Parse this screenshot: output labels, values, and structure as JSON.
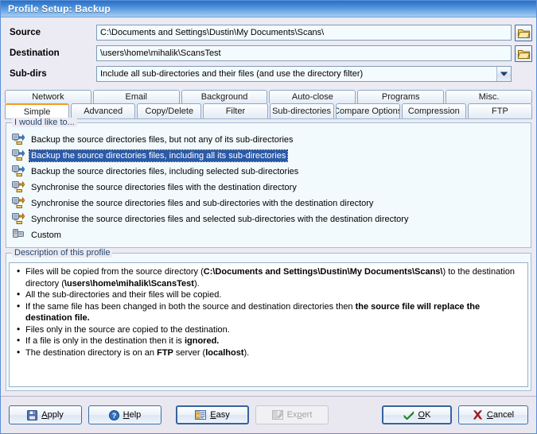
{
  "window": {
    "title": "Profile Setup: Backup"
  },
  "fields": {
    "source": {
      "label": "Source",
      "value": "C:\\Documents and Settings\\Dustin\\My Documents\\Scans\\",
      "placeholder": "",
      "browse_icon": "folder-open-icon"
    },
    "destination": {
      "label": "Destination",
      "value": "\\users\\home\\mihalik\\ScansTest",
      "placeholder": "",
      "browse_icon": "folder-open-icon"
    },
    "subdirs": {
      "label": "Sub-dirs",
      "value": "Include all sub-directories and their files (and use the directory filter)",
      "arrow_icon": "chevron-down-icon"
    }
  },
  "tabs": {
    "row1": [
      {
        "label": "Network",
        "active": false
      },
      {
        "label": "Email",
        "active": false
      },
      {
        "label": "Background",
        "active": false
      },
      {
        "label": "Auto-close",
        "active": false
      },
      {
        "label": "Programs",
        "active": false
      },
      {
        "label": "Misc.",
        "active": false
      }
    ],
    "row2": [
      {
        "label": "Simple",
        "active": true
      },
      {
        "label": "Advanced",
        "active": false
      },
      {
        "label": "Copy/Delete",
        "active": false
      },
      {
        "label": "Filter",
        "active": false
      },
      {
        "label": "Sub-directories",
        "active": false
      },
      {
        "label": "Compare Options",
        "active": false
      },
      {
        "label": "Compression",
        "active": false
      },
      {
        "label": "FTP",
        "active": false
      }
    ]
  },
  "actions_group": {
    "title": "I would like to...",
    "items": [
      {
        "label": "Backup the source directories files, but not any of its sub-directories",
        "icon": "backup-computer-icon",
        "selected": false
      },
      {
        "label": "Backup the source directories files, including all its sub-directories",
        "icon": "backup-computer-icon",
        "selected": true
      },
      {
        "label": "Backup the source directories files, including selected sub-directories",
        "icon": "backup-computer-icon",
        "selected": false
      },
      {
        "label": "Synchronise the source directories files with the destination directory",
        "icon": "sync-computer-icon",
        "selected": false
      },
      {
        "label": "Synchronise the source directories files and sub-directories with the destination directory",
        "icon": "sync-computer-icon",
        "selected": false
      },
      {
        "label": "Synchronise the source directories files and selected sub-directories with the destination directory",
        "icon": "sync-computer-icon",
        "selected": false
      },
      {
        "label": "Custom",
        "icon": "custom-computer-icon",
        "selected": false
      }
    ]
  },
  "description_group": {
    "title": "Description of this profile",
    "bullets": [
      [
        {
          "t": "Files will be copied from the source directory (",
          "b": false
        },
        {
          "t": "C:\\Documents and Settings\\Dustin\\My Documents\\Scans\\",
          "b": true
        },
        {
          "t": ") to the destination directory (",
          "b": false
        },
        {
          "t": "\\users\\home\\mihalik\\ScansTest",
          "b": true
        },
        {
          "t": ").",
          "b": false
        }
      ],
      [
        {
          "t": "All the sub-directories and their files will be copied.",
          "b": false
        }
      ],
      [
        {
          "t": "If the same file has been changed in both the source and destination directories then ",
          "b": false
        },
        {
          "t": "the source file will replace the destination file.",
          "b": true
        }
      ],
      [
        {
          "t": "Files only in the source are copied to the destination.",
          "b": false
        }
      ],
      [
        {
          "t": "If a file is only in the destination then it is ",
          "b": false
        },
        {
          "t": "ignored.",
          "b": true
        }
      ],
      [
        {
          "t": "The destination directory is on an ",
          "b": false
        },
        {
          "t": "FTP",
          "b": true
        },
        {
          "t": " server (",
          "b": false
        },
        {
          "t": "localhost",
          "b": true
        },
        {
          "t": ").",
          "b": false
        }
      ]
    ]
  },
  "buttons": {
    "apply": {
      "label": "Apply",
      "accel": "A",
      "icon": "floppy-save-icon",
      "disabled": false
    },
    "help": {
      "label": "Help",
      "accel": "H",
      "icon": "question-circle-icon",
      "disabled": false
    },
    "easy": {
      "label": "Easy",
      "accel": "E",
      "icon": "id-card-icon",
      "disabled": false,
      "focused": true
    },
    "expert": {
      "label": "Expert",
      "accel": "p",
      "icon": "expert-tool-icon",
      "disabled": true
    },
    "ok": {
      "label": "OK",
      "accel": "O",
      "icon": "check-icon",
      "disabled": false,
      "default": true
    },
    "cancel": {
      "label": "Cancel",
      "accel": "C",
      "icon": "x-cross-icon",
      "disabled": false
    }
  },
  "colors": {
    "titlebar_blue": "#3f85d6",
    "selection_blue": "#2b5aa8",
    "active_tab_accent": "#ef9b20",
    "panel_bg": "#f2fafd",
    "dialog_bg": "#eceaf2",
    "folder_yellow": "#f0c040",
    "ok_check_green": "#1f9a1f",
    "cancel_x_red": "#b01818"
  }
}
